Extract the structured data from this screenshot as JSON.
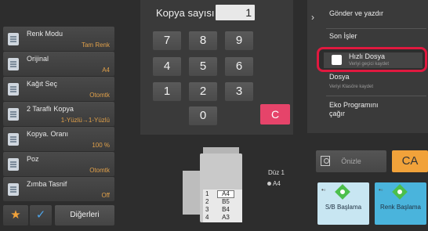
{
  "functions": [
    {
      "title": "Renk Modu",
      "value": "Tam Renk",
      "icon": "color-mode-icon"
    },
    {
      "title": "Orijinal",
      "value": "A4",
      "icon": "original-icon"
    },
    {
      "title": "Kağıt Seç",
      "value": "Otomtk",
      "icon": "paper-select-icon"
    },
    {
      "title": "2 Taraflı Kopya",
      "value": "1-Yüzlü→1-Yüzlü",
      "icon": "duplex-icon"
    },
    {
      "title": "Kopya. Oranı",
      "value": "100 %",
      "icon": "ratio-icon"
    },
    {
      "title": "Poz",
      "value": "Otomtk",
      "icon": "exposure-icon"
    },
    {
      "title": "Zımba Tasnif",
      "value": "Off",
      "icon": "staple-icon"
    }
  ],
  "bottom_bar": {
    "others_label": "Diğerleri"
  },
  "keypad": {
    "copies_label": "Kopya sayısı",
    "copies_value": "1",
    "keys": [
      "7",
      "8",
      "9",
      "4",
      "5",
      "6",
      "1",
      "2",
      "3",
      "0"
    ],
    "clear_label": "C"
  },
  "machine": {
    "trays": [
      {
        "num": "1",
        "size": "A4"
      },
      {
        "num": "2",
        "size": "B5"
      },
      {
        "num": "3",
        "size": "B4"
      },
      {
        "num": "4",
        "size": "A3"
      }
    ],
    "duz_label": "Düz 1",
    "duz_size": "A4"
  },
  "actions": {
    "send_print": "Gönder ve yazdır",
    "saved_jobs": "Son İşler",
    "quick_file": "Hızlı Dosya",
    "quick_file_sub": "Veriyi geçici kaydet",
    "file": "Dosya",
    "file_sub": "Veriyi Klasöre kaydet",
    "eco_program": "Eko Programını çağır"
  },
  "preview_label": "Önizle",
  "ca_label": "CA",
  "start_bw": "S/B Başlama",
  "start_color": "Renk Başlama",
  "colors": {
    "accent_red": "#e0193f",
    "value_orange": "#e0a04a",
    "clear_pink": "#e6446a",
    "ca_orange": "#f1a23a"
  }
}
